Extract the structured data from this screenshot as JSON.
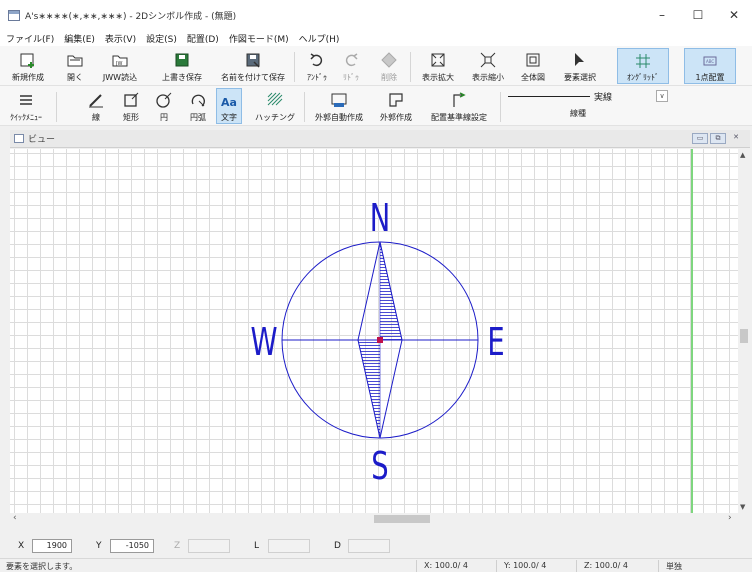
{
  "window": {
    "title": "A's∗∗∗∗(∗,∗∗,∗∗∗) - 2Dシンボル作成 - (無題)",
    "minimize": "–",
    "maximize": "☐",
    "close": "✕"
  },
  "menu": [
    "ファイル(F)",
    "編集(E)",
    "表示(V)",
    "設定(S)",
    "配置(D)",
    "作図モード(M)",
    "ヘルプ(H)"
  ],
  "toolbar1": {
    "new": "新規作成",
    "open": "開く",
    "jww_read": "JWW読込",
    "overwrite_save": "上書き保存",
    "save_as": "名前を付けて保存",
    "undo": "ｱﾝﾄﾞｩ",
    "redo": "ﾘﾄﾞｩ",
    "delete": "削除",
    "zoom_in": "表示拡大",
    "zoom_out": "表示縮小",
    "fit_all": "全体図",
    "select": "要素選択",
    "on_grid": "ｵﾝｸﾞﾘｯﾄﾞ",
    "one_point": "1点配置"
  },
  "toolbar2": {
    "quick_menu": "ｸｲｯｸﾒﾆｭｰ",
    "line": "線",
    "rect": "矩形",
    "circle": "円",
    "arc": "円弧",
    "text": "文字",
    "hatching": "ハッチング",
    "auto_outline": "外郭自動作成",
    "outline": "外郭作成",
    "placement_line": "配置基準線設定",
    "linetype_value": "実線",
    "linetype_label": "線種"
  },
  "view": {
    "title": "ビュー",
    "labels": {
      "n": "N",
      "s": "S",
      "w": "W",
      "e": "E"
    }
  },
  "coords": {
    "x_label": "X",
    "x_value": "1900",
    "y_label": "Y",
    "y_value": "-1050",
    "z_label": "Z",
    "l_label": "L",
    "d_label": "D"
  },
  "status": {
    "message": "要素を選択します。",
    "x": "X: 100.0/ 4",
    "y": "Y: 100.0/ 4",
    "z": "Z: 100.0/ 4",
    "mode": "単独"
  },
  "colors": {
    "compass_blue": "#1c1cc8",
    "center_marker": "#c0104a",
    "guide_green": "#7ed67e"
  }
}
